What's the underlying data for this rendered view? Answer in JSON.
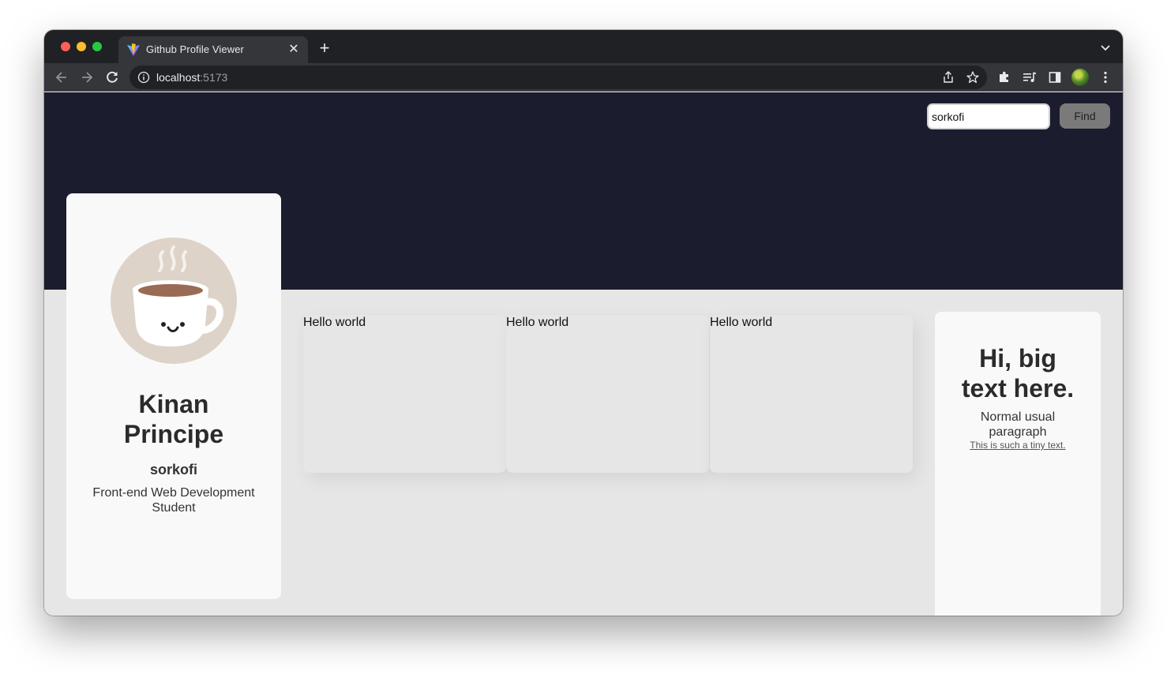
{
  "browser": {
    "tab_title": "Github Profile Viewer",
    "url_host": "localhost",
    "url_port": ":5173"
  },
  "search": {
    "value": "sorkofi",
    "button_label": "Find"
  },
  "profile": {
    "name": "Kinan Principe",
    "username": "sorkofi",
    "bio": "Front-end Web Development Student",
    "avatar_icon": "coffee-cup-icon"
  },
  "cards": [
    {
      "label": "Hello world"
    },
    {
      "label": "Hello world"
    },
    {
      "label": "Hello world"
    }
  ],
  "info": {
    "heading": "Hi, big text here.",
    "paragraph": "Normal usual paragraph",
    "small": "This is such a tiny text."
  },
  "colors": {
    "hero_bg": "#1b1c2e",
    "page_bg": "#e6e6e6",
    "card_bg": "#f9f9f9",
    "find_button": "#7a7a7a"
  }
}
